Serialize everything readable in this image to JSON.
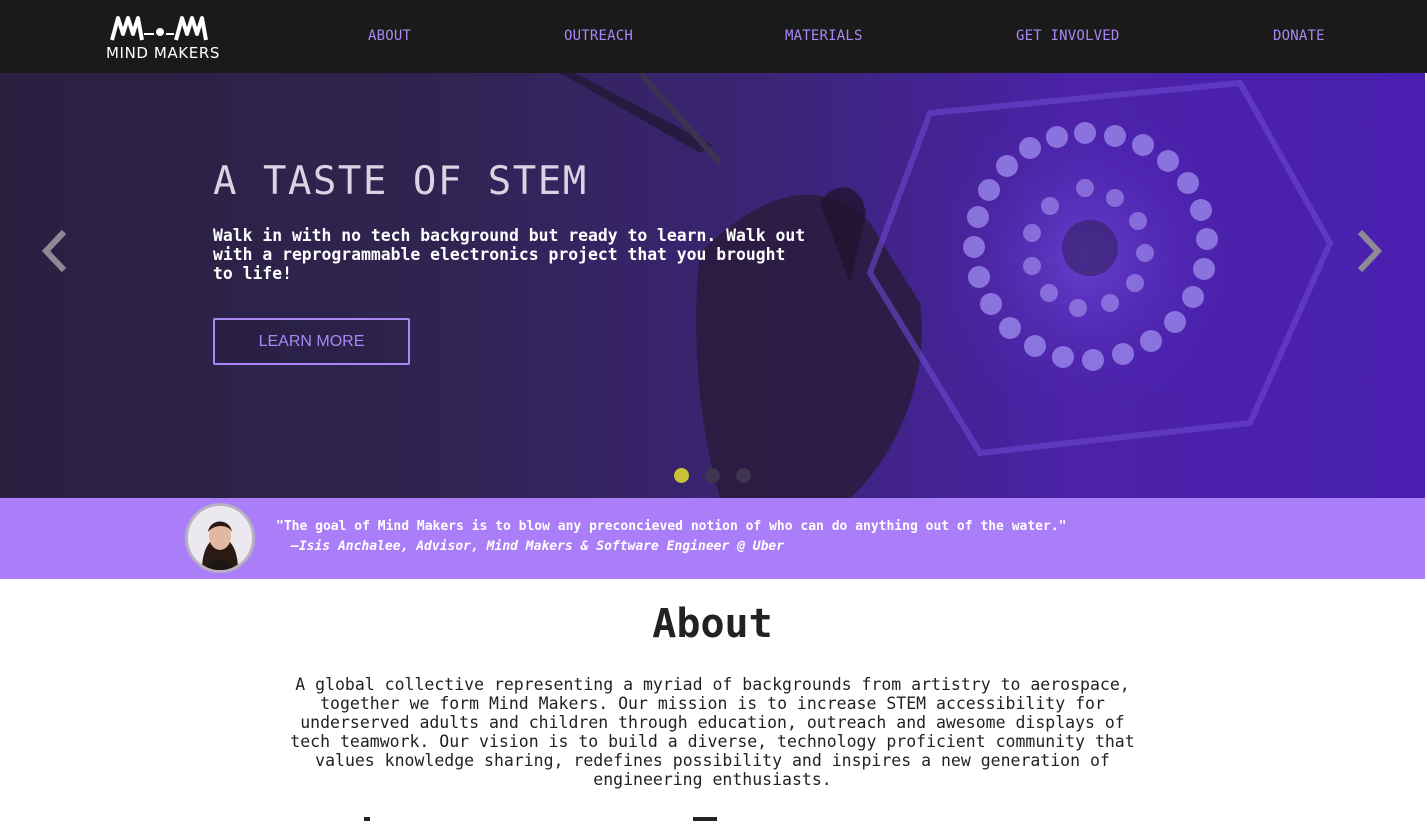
{
  "brand": {
    "name": "MIND MAKERS",
    "logo_icon": "mind-makers-logo-icon"
  },
  "nav": {
    "links": [
      {
        "label": "ABOUT"
      },
      {
        "label": "OUTREACH"
      },
      {
        "label": "MATERIALS"
      },
      {
        "label": "GET INVOLVED"
      },
      {
        "label": "DONATE"
      }
    ]
  },
  "hero": {
    "title": "A TASTE OF STEM",
    "text": "Walk in with no tech background but ready to learn. Walk out with a reprogrammable electronics project that you brought to life!",
    "button_label": "LEARN MORE",
    "prev_icon": "chevron-left-icon",
    "next_icon": "chevron-right-icon",
    "slides": {
      "count": 3,
      "active": 1
    }
  },
  "quote": {
    "text": "\"The goal of Mind Makers is to blow any preconcieved notion of who can do anything out of the water.\"",
    "author": "—Isis Anchalee, Advisor, Mind Makers & Software Engineer @ Uber"
  },
  "about": {
    "title": "About",
    "body": "A global collective representing a myriad of backgrounds from artistry to aerospace, together we form Mind Makers. Our mission is to increase STEM accessibility for underserved adults and children through education, outreach and awesome displays of tech teamwork. Our vision is to build a diverse, technology proficient community that values knowledge sharing, redefines possibility and inspires a new generation of engineering enthusiasts."
  },
  "colors": {
    "accent": "#a987f5",
    "nav_bg": "#1b1a1b",
    "quote_bg": "#a97ef8",
    "dot_active": "#c8c23a",
    "dot_inactive": "#3e3650"
  }
}
